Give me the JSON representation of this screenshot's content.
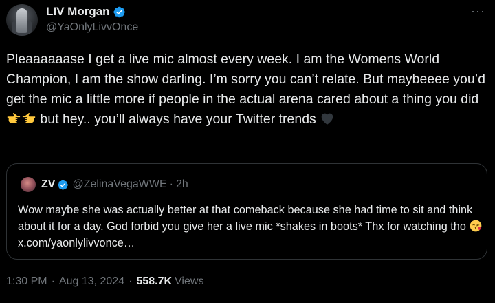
{
  "author": {
    "display_name": "LIV Morgan",
    "handle": "@YaOnlyLivvOnce"
  },
  "tweet": {
    "text_parts": [
      "Pleaaaaaase I get a live mic almost every week. I am the Womens World Champion, I am the show darling. I’m sorry you can’t relate. But maybeeee you’d get the mic a little more if people in the actual arena cared about a thing you did ",
      " but hey.. you’ll always have your Twitter trends "
    ]
  },
  "quote": {
    "display_name": "ZV",
    "handle": "@ZelinaVegaWWE",
    "separator": "·",
    "time": "2h",
    "text": "Wow maybe she was actually better at that comeback because she had time to sit and think about it for a day. God forbid you give her a live mic *shakes in boots* Thx for watching tho ",
    "link": "x.com/yaonlylivvonce…"
  },
  "meta": {
    "time": "1:30 PM",
    "date": "Aug 13, 2024",
    "separator": "·",
    "views_count": "558.7K",
    "views_label": "Views"
  },
  "icons": {
    "verified": "verified-badge-icon",
    "more": "more-options-icon",
    "pointing_right": "pointing-right-emoji",
    "pointing_left": "pointing-left-emoji",
    "black_heart": "black-heart-emoji",
    "kiss_face": "face-blowing-kiss-emoji"
  },
  "colors": {
    "background": "#000000",
    "text": "#e7e9ea",
    "secondary": "#71767b",
    "verified": "#1d9bf0",
    "border": "#2f3336"
  }
}
